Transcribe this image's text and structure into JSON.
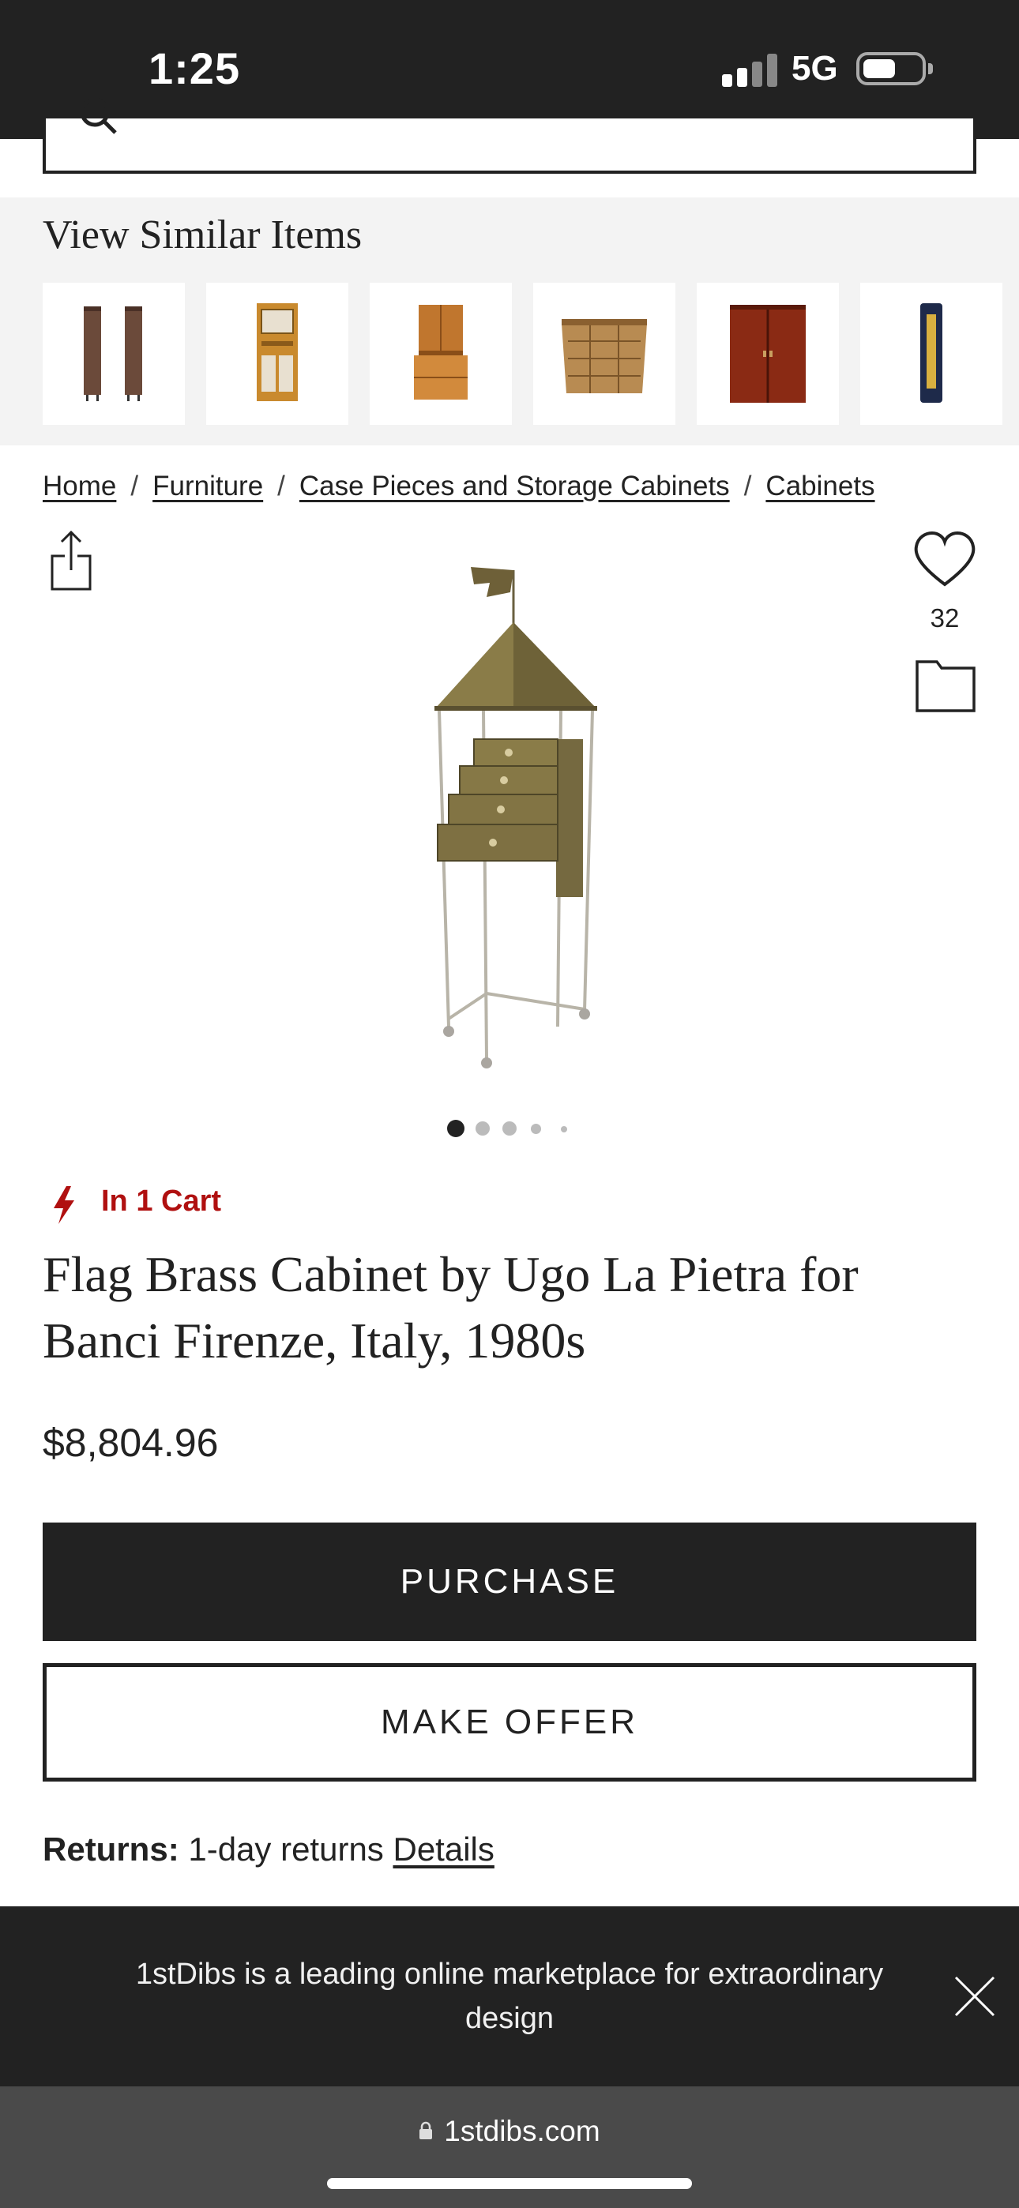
{
  "status_bar": {
    "time": "1:25",
    "network": "5G"
  },
  "similar_items": {
    "title": "View Similar Items",
    "items": [
      {
        "name": "thumb-1",
        "color": "#6b4a3a"
      },
      {
        "name": "thumb-2",
        "color": "#c98a2e"
      },
      {
        "name": "thumb-3",
        "color": "#c0762e"
      },
      {
        "name": "thumb-4",
        "color": "#b88b52"
      },
      {
        "name": "thumb-5",
        "color": "#8a2a14"
      },
      {
        "name": "thumb-6",
        "color": "#1e2a4a"
      }
    ]
  },
  "breadcrumb": {
    "items": [
      "Home",
      "Furniture",
      "Case Pieces and Storage Cabinets",
      "Cabinets"
    ],
    "separator": "/"
  },
  "product": {
    "like_count": "32",
    "image_count": 5,
    "active_image": 1,
    "cart_status": "In 1 Cart",
    "title": "Flag Brass Cabinet by Ugo La Pietra for Banci Firenze, Italy, 1980s",
    "price": "$8,804.96"
  },
  "actions": {
    "purchase_label": "PURCHASE",
    "offer_label": "MAKE OFFER"
  },
  "returns": {
    "label": "Returns:",
    "value": "1-day returns",
    "link": "Details"
  },
  "banner": {
    "text": "1stDibs is a leading online marketplace for extraordinary design"
  },
  "browser": {
    "url": "1stdibs.com"
  },
  "colors": {
    "dark": "#222222",
    "accent_red": "#b01010",
    "similar_bg": "#f3f3f3"
  }
}
